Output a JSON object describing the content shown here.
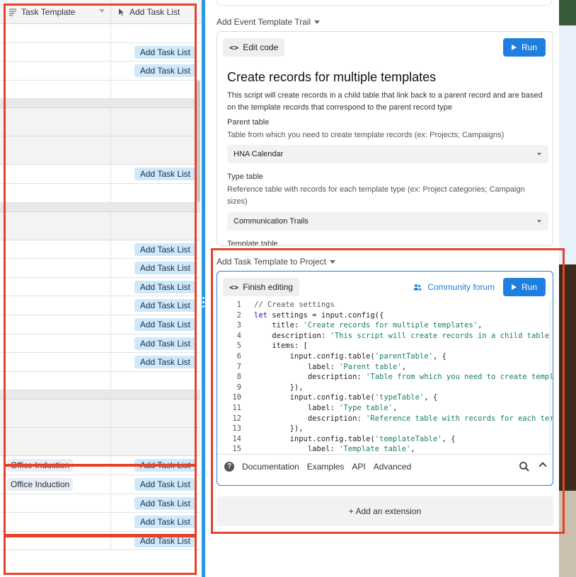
{
  "grid": {
    "columns": [
      {
        "label": "Task Template",
        "icon": "multiline-field-icon"
      },
      {
        "label": "Add Task List",
        "icon": "cursor-button-icon"
      }
    ],
    "rows": [
      {
        "kind": "normal",
        "template": "",
        "button": ""
      },
      {
        "kind": "normal",
        "template": "",
        "button": "Add Task List"
      },
      {
        "kind": "normal",
        "template": "",
        "button": "Add Task List"
      },
      {
        "kind": "normal",
        "template": "",
        "button": ""
      },
      {
        "kind": "sep",
        "template": "",
        "button": ""
      },
      {
        "kind": "group",
        "template": "",
        "button": ""
      },
      {
        "kind": "group",
        "template": "",
        "button": ""
      },
      {
        "kind": "normal",
        "template": "",
        "button": "Add Task List"
      },
      {
        "kind": "normal",
        "template": "",
        "button": ""
      },
      {
        "kind": "sep",
        "template": "",
        "button": ""
      },
      {
        "kind": "group",
        "template": "",
        "button": ""
      },
      {
        "kind": "normal",
        "template": "",
        "button": "Add Task List"
      },
      {
        "kind": "normal",
        "template": "",
        "button": "Add Task List"
      },
      {
        "kind": "normal",
        "template": "",
        "button": "Add Task List"
      },
      {
        "kind": "normal",
        "template": "",
        "button": "Add Task List"
      },
      {
        "kind": "normal",
        "template": "",
        "button": "Add Task List"
      },
      {
        "kind": "normal",
        "template": "",
        "button": "Add Task List"
      },
      {
        "kind": "normal",
        "template": "",
        "button": "Add Task List"
      },
      {
        "kind": "normal",
        "template": "",
        "button": ""
      },
      {
        "kind": "sep",
        "template": "",
        "button": ""
      },
      {
        "kind": "group",
        "template": "",
        "button": ""
      },
      {
        "kind": "group",
        "template": "",
        "button": ""
      },
      {
        "kind": "normal",
        "template": "Office Induction",
        "button": "Add Task List"
      },
      {
        "kind": "normal",
        "template": "Office Induction",
        "button": "Add Task List"
      },
      {
        "kind": "normal",
        "template": "",
        "button": "Add Task List"
      },
      {
        "kind": "normal",
        "template": "",
        "button": "Add Task List"
      },
      {
        "kind": "normal",
        "template": "",
        "button": "Add Task List"
      }
    ]
  },
  "extension1": {
    "title": "Add Event Template Trail",
    "edit_label": "Edit code",
    "run_label": "Run",
    "heading": "Create records for multiple templates",
    "description": "This script will create records in a child table that link back to a parent record and are based on the template records that correspond to the parent record type",
    "parent_label": "Parent table",
    "parent_desc": "Table from which you need to create template records (ex: Projects; Campaigns)",
    "parent_value": "HNA Calendar",
    "type_label": "Type table",
    "type_desc": "Reference table with records for each template type (ex: Project categories; Campaign sizes)",
    "type_value": "Communication Trails",
    "template_label": "Template table"
  },
  "extension2": {
    "title": "Add Task Template to Project",
    "finish_label": "Finish editing",
    "forum_label": "Community forum",
    "run_label": "Run",
    "code_lines": [
      {
        "n": "1",
        "parts": [
          {
            "c": "cmt",
            "t": "// Create settings"
          }
        ]
      },
      {
        "n": "2",
        "parts": [
          {
            "c": "kw",
            "t": "let"
          },
          {
            "c": "tx",
            "t": " settings = input.config({"
          }
        ]
      },
      {
        "n": "3",
        "parts": [
          {
            "c": "tx",
            "t": "    title: "
          },
          {
            "c": "str",
            "t": "'Create records for multiple templates'"
          },
          {
            "c": "tx",
            "t": ","
          }
        ]
      },
      {
        "n": "4",
        "parts": [
          {
            "c": "tx",
            "t": "    description: "
          },
          {
            "c": "str",
            "t": "'This script will create records in a child table that"
          }
        ]
      },
      {
        "n": "5",
        "parts": [
          {
            "c": "tx",
            "t": "    items: ["
          }
        ]
      },
      {
        "n": "6",
        "parts": [
          {
            "c": "tx",
            "t": "        input.config.table("
          },
          {
            "c": "str",
            "t": "'parentTable'"
          },
          {
            "c": "tx",
            "t": ", {"
          }
        ]
      },
      {
        "n": "7",
        "parts": [
          {
            "c": "tx",
            "t": "            label: "
          },
          {
            "c": "str",
            "t": "'Parent table'"
          },
          {
            "c": "tx",
            "t": ","
          }
        ]
      },
      {
        "n": "8",
        "parts": [
          {
            "c": "tx",
            "t": "            description: "
          },
          {
            "c": "str",
            "t": "'Table from which you need to create template"
          }
        ]
      },
      {
        "n": "9",
        "parts": [
          {
            "c": "tx",
            "t": "        }),"
          }
        ]
      },
      {
        "n": "10",
        "parts": [
          {
            "c": "tx",
            "t": "        input.config.table("
          },
          {
            "c": "str",
            "t": "'typeTable'"
          },
          {
            "c": "tx",
            "t": ", {"
          }
        ]
      },
      {
        "n": "11",
        "parts": [
          {
            "c": "tx",
            "t": "            label: "
          },
          {
            "c": "str",
            "t": "'Type table'"
          },
          {
            "c": "tx",
            "t": ","
          }
        ]
      },
      {
        "n": "12",
        "parts": [
          {
            "c": "tx",
            "t": "            description: "
          },
          {
            "c": "str",
            "t": "'Reference table with records for each template"
          }
        ]
      },
      {
        "n": "13",
        "parts": [
          {
            "c": "tx",
            "t": "        }),"
          }
        ]
      },
      {
        "n": "14",
        "parts": [
          {
            "c": "tx",
            "t": "        input.config.table("
          },
          {
            "c": "str",
            "t": "'templateTable'"
          },
          {
            "c": "tx",
            "t": ", {"
          }
        ]
      },
      {
        "n": "15",
        "parts": [
          {
            "c": "tx",
            "t": "            label: "
          },
          {
            "c": "str",
            "t": "'Template table'"
          },
          {
            "c": "tx",
            "t": ","
          }
        ]
      }
    ],
    "footer": {
      "documentation": "Documentation",
      "examples": "Examples",
      "api": "API",
      "advanced": "Advanced"
    }
  },
  "add_extension_label": "+ Add an extension",
  "colors": {
    "accent": "#1f7fe0",
    "annotation": "#e4432b",
    "button_pill": "#cfe9fb",
    "divider": "#2b97dd"
  }
}
